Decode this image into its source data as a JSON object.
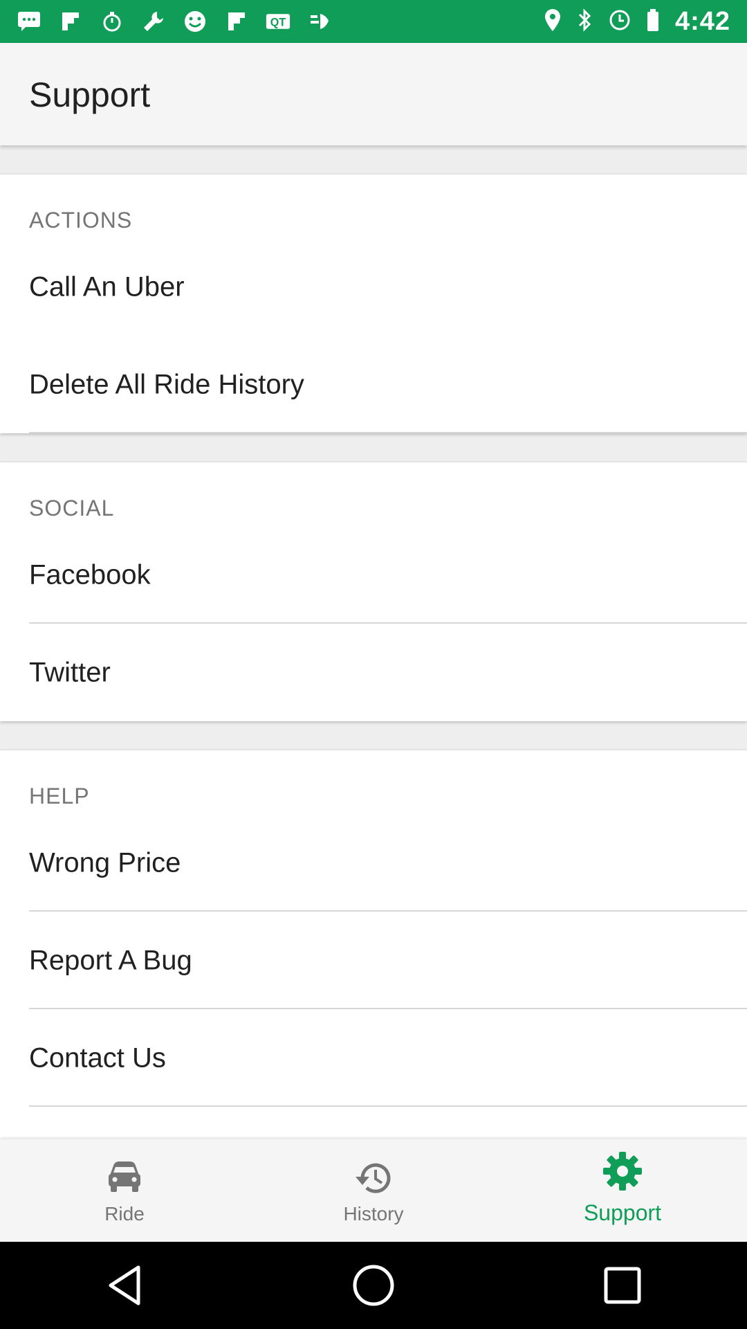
{
  "status_bar": {
    "time": "4:42",
    "icons": [
      "chat-icon",
      "flipboard-icon",
      "stopwatch-icon",
      "wrench-icon",
      "smiley-icon",
      "flipboard-icon",
      "qt-icon",
      "app-icon",
      "location-icon",
      "bluetooth-icon",
      "clock-icon",
      "battery-icon"
    ]
  },
  "app_bar": {
    "title": "Support"
  },
  "sections": {
    "actions": {
      "label": "ACTIONS",
      "items": [
        {
          "label": "Call An Uber"
        },
        {
          "label": "Delete All Ride History"
        }
      ]
    },
    "social": {
      "label": "SOCIAL",
      "items": [
        {
          "label": "Facebook"
        },
        {
          "label": "Twitter"
        }
      ]
    },
    "help": {
      "label": "HELP",
      "items": [
        {
          "label": "Wrong Price"
        },
        {
          "label": "Report A Bug"
        },
        {
          "label": "Contact Us"
        }
      ]
    }
  },
  "bottom_nav": {
    "items": [
      {
        "label": "Ride",
        "icon": "car-icon"
      },
      {
        "label": "History",
        "icon": "history-icon"
      },
      {
        "label": "Support",
        "icon": "gear-icon",
        "active": true
      }
    ]
  },
  "colors": {
    "accent": "#0f9d58",
    "status_bar": "#0f9d58",
    "text_primary": "#212121",
    "text_secondary": "#757575"
  }
}
